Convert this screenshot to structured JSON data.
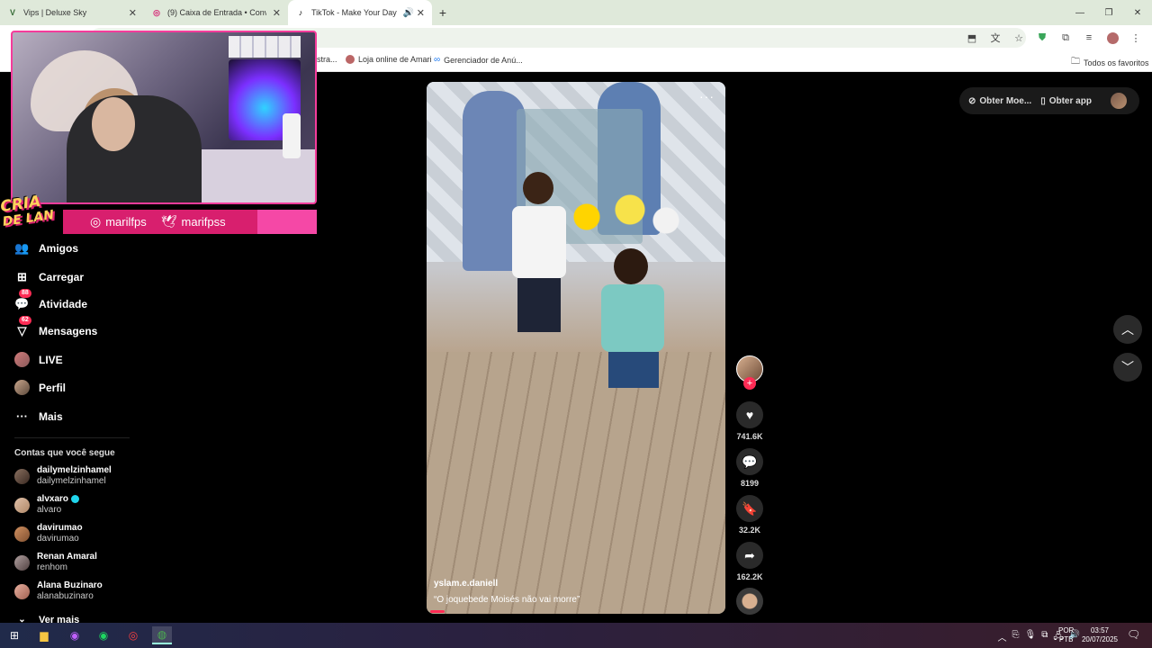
{
  "tabs": [
    {
      "title": "Vips | Deluxe Sky",
      "favicon": "V",
      "color": "#3a6e3a",
      "active": false
    },
    {
      "title": "(9) Caixa de Entrada • Convers...",
      "favicon": "◎",
      "color": "#d62976",
      "active": false
    },
    {
      "title": "TikTok - Make Your Day",
      "favicon": "♪",
      "color": "#000000",
      "active": true
    }
  ],
  "bookmarks": [
    {
      "label": "stra..."
    },
    {
      "label": "Loja online de Amari"
    },
    {
      "label": "Gerenciador de Anú..."
    },
    {
      "label": "Todos os favoritos"
    }
  ],
  "overlay": {
    "logo_line1": "CRIA",
    "logo_line2": "DE LAN",
    "instagram": "marilfps",
    "twitter": "marifpss"
  },
  "sidebar": {
    "items": [
      {
        "label": "Amigos",
        "icon": "friends-icon"
      },
      {
        "label": "Carregar",
        "icon": "upload-icon"
      },
      {
        "label": "Atividade",
        "icon": "activity-icon",
        "badge": "88"
      },
      {
        "label": "Mensagens",
        "icon": "messages-icon",
        "badge": "62"
      },
      {
        "label": "LIVE",
        "icon": "live-icon"
      },
      {
        "label": "Perfil",
        "icon": "profile-icon"
      },
      {
        "label": "Mais",
        "icon": "more-icon"
      }
    ],
    "following_title": "Contas que você segue",
    "accounts": [
      {
        "name": "dailymelzinhamel",
        "handle": "dailymelzinhamel",
        "verified": false
      },
      {
        "name": "alvxaro",
        "handle": "alvaro",
        "verified": true
      },
      {
        "name": "davirumao",
        "handle": "davirumao",
        "verified": false
      },
      {
        "name": "Renan Amaral",
        "handle": "renhom",
        "verified": false
      },
      {
        "name": "Alana Buzinaro",
        "handle": "alanabuzinaro",
        "verified": false
      }
    ],
    "see_more": "Ver mais"
  },
  "topbar": {
    "coins": "Obter Moe...",
    "app": "Obter app"
  },
  "video": {
    "username": "yslam.e.daniell",
    "caption": "“O joquebede Moisés não vai morre”",
    "progress": 0.05
  },
  "actions": {
    "likes": "741.6K",
    "comments": "8199",
    "saves": "32.2K",
    "shares": "162.2K"
  },
  "taskbar": {
    "lang_line1": "POR",
    "lang_line2": "PTB",
    "time": "03:57",
    "date": "20/07/2025"
  }
}
